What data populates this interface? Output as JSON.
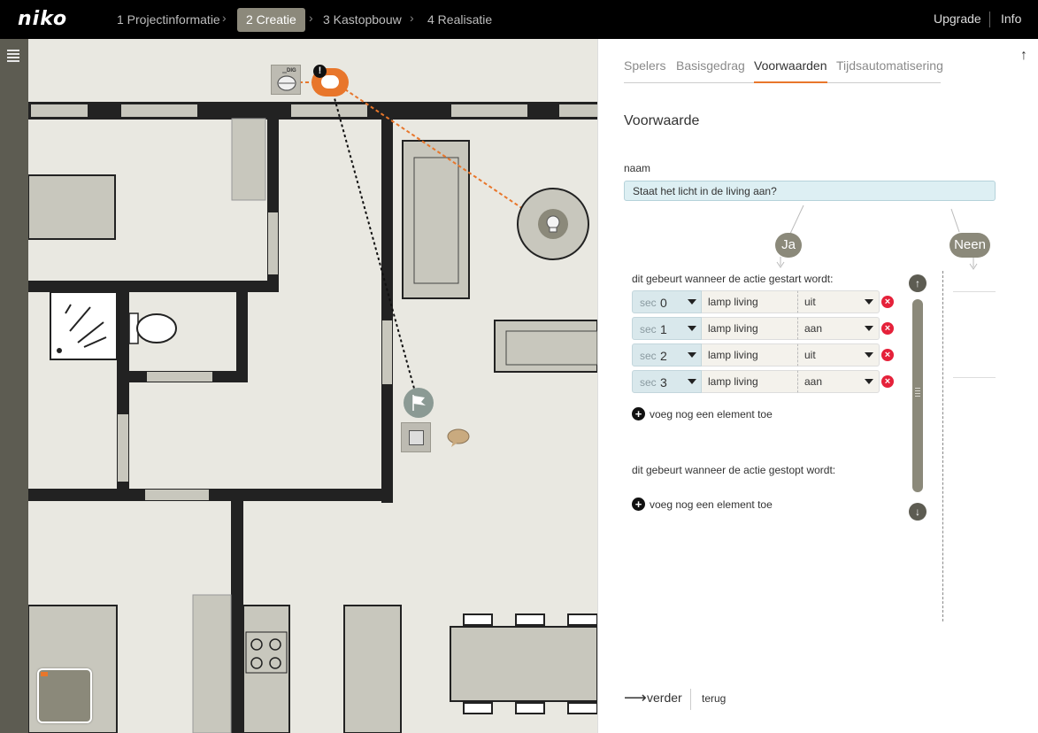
{
  "brand": "niko",
  "steps": [
    {
      "label": "1 Projectinformatie",
      "active": false
    },
    {
      "label": "2 Creatie",
      "active": true
    },
    {
      "label": "3 Kastopbouw",
      "active": false
    },
    {
      "label": "4 Realisatie",
      "active": false
    }
  ],
  "top_links": {
    "upgrade": "Upgrade",
    "info": "Info"
  },
  "plan": {
    "device_label": "DIG",
    "warning": "!"
  },
  "tabs": [
    {
      "label": "Spelers",
      "active": false
    },
    {
      "label": "Basisgedrag",
      "active": false
    },
    {
      "label": "Voorwaarden",
      "active": true
    },
    {
      "label": "Tijdsautomatisering",
      "active": false
    }
  ],
  "form": {
    "title": "Voorwaarde",
    "name_label": "naam",
    "name_value": "Staat het licht in de living aan?"
  },
  "branches": {
    "yes": "Ja",
    "no": "Neen"
  },
  "started": {
    "label": "dit gebeurt wanneer de actie gestart wordt:",
    "rows": [
      {
        "sec_label": "sec",
        "sec": "0",
        "element": "lamp living",
        "state": "uit"
      },
      {
        "sec_label": "sec",
        "sec": "1",
        "element": "lamp living",
        "state": "aan"
      },
      {
        "sec_label": "sec",
        "sec": "2",
        "element": "lamp living",
        "state": "uit"
      },
      {
        "sec_label": "sec",
        "sec": "3",
        "element": "lamp living",
        "state": "aan"
      }
    ],
    "add_label": "voeg nog een element toe"
  },
  "stopped": {
    "label": "dit gebeurt wanneer de actie gestopt wordt:",
    "add_label": "voeg nog een element toe"
  },
  "footer": {
    "next": "verder",
    "back": "terug"
  },
  "colors": {
    "accent": "#e8762b",
    "active_step": "#8c897b",
    "wall": "#222222",
    "floor": "#e9e8e1",
    "furniture": "#c8c7bd",
    "remove": "#e5213a"
  }
}
